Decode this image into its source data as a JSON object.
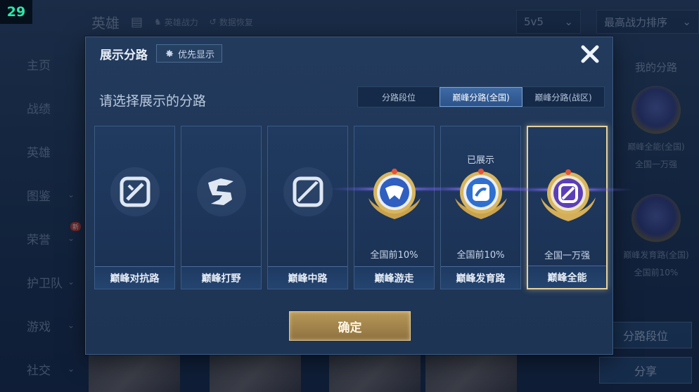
{
  "fps": "29",
  "background": {
    "top_title": "英雄",
    "top_links": [
      "英雄战力",
      "数据恢复"
    ],
    "mode_dropdown": "5v5",
    "sort_dropdown": "最高战力排序",
    "sidenav": [
      {
        "label": "主页",
        "chevron": false
      },
      {
        "label": "战绩",
        "chevron": false
      },
      {
        "label": "英雄",
        "chevron": false
      },
      {
        "label": "图鉴",
        "chevron": true
      },
      {
        "label": "荣誉",
        "chevron": true,
        "badge": "新"
      },
      {
        "label": "护卫队",
        "chevron": true
      },
      {
        "label": "游戏",
        "chevron": true
      },
      {
        "label": "社交",
        "chevron": true
      }
    ],
    "right_panel": {
      "title": "我的分路",
      "items": [
        {
          "name": "巅峰全能(全国)",
          "rank": "全国一万强"
        },
        {
          "name": "巅峰发育路(全国)",
          "rank": "全国前10%"
        }
      ],
      "lane_rank_button": "分路段位",
      "share_button": "分享"
    }
  },
  "modal": {
    "title": "展示分路",
    "priority_button": "优先显示",
    "subtitle": "请选择展示的分路",
    "tabs": [
      {
        "label": "分路段位",
        "active": false
      },
      {
        "label": "巅峰分路(全国)",
        "active": true
      },
      {
        "label": "巅峰分路(战区)",
        "active": false
      }
    ],
    "cards": [
      {
        "label": "巅峰对抗路",
        "icon": "sword-shield-icon",
        "rank": "",
        "shown": "",
        "selected": false
      },
      {
        "label": "巅峰打野",
        "icon": "dragon-icon",
        "rank": "",
        "shown": "",
        "selected": false
      },
      {
        "label": "巅峰中路",
        "icon": "mid-lane-icon",
        "rank": "",
        "shown": "",
        "selected": false
      },
      {
        "label": "巅峰游走",
        "icon": "roam-medal-icon",
        "rank": "全国前10%",
        "shown": "",
        "selected": false
      },
      {
        "label": "巅峰发育路",
        "icon": "farm-medal-icon",
        "rank": "全国前10%",
        "shown": "已展示",
        "selected": false
      },
      {
        "label": "巅峰全能",
        "icon": "allround-medal-icon",
        "rank": "全国一万强",
        "shown": "",
        "selected": true
      }
    ],
    "confirm_button": "确定"
  },
  "colors": {
    "accent_gold": "#e6d29c",
    "active_tab": "#3e6aa4",
    "medal_purple": "#5b3fb8",
    "medal_blue": "#2f69c6"
  }
}
